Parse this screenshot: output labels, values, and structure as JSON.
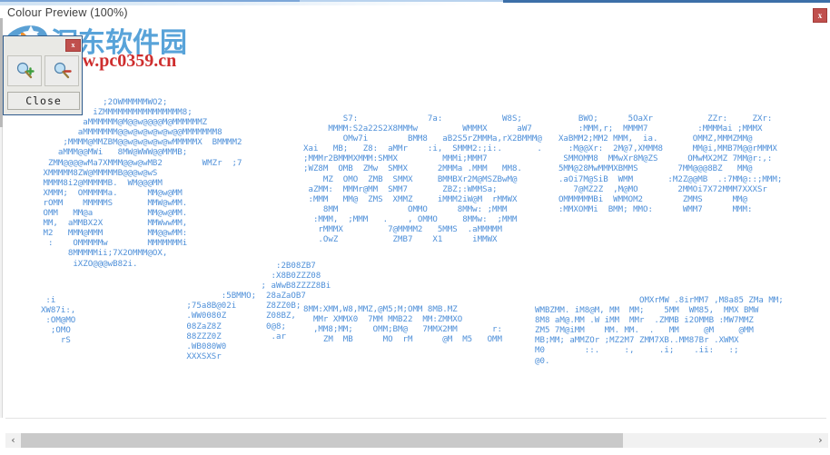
{
  "window": {
    "title": "Colour Preview (100%)",
    "close_label": "x"
  },
  "palette": {
    "close_x_label": "x",
    "zoom_in_icon": "zoom-in-magnifier-icon",
    "zoom_out_icon": "zoom-out-magnifier-icon",
    "close_label": "Close"
  },
  "watermark": {
    "site_name_cn": "洄东软件园",
    "site_url": "www.pc0359.cn"
  },
  "scrollbars": {
    "h_left_arrow": "‹",
    "h_right_arrow": "›"
  },
  "ascii_art": {
    "block_1_blue": "             ;2OWMMMMMWO2;\n           iZMMMMMMMMMMMMMMMM8;\n         aMMMMMM@M@@w@@@@M@MMMMMMZ\n        aMMMMMMM@@w@w@w@w@w@@MMMMMMM8\n     ;MMMM@MMZBM@@w@w@w@w@wMMMMMX  BMMMM2\n    aMMM@@MWi   8MW@WWW@@MMMB;\n  ZMM@@@@wMa7XMMM@@w@wMB2        WMZr  ;7\n XMMMMM8ZW@MMMMMB@@@w@wS\n MMMM8i2@MMMMMB.  WM@@@MM\n XMMM;  OMMMMMa.      MM@w@MM\n rOMM    MMMMMS       MMW@wMM.\n OMM   MM@a           MM@w@MM.\n MM,  aMMBX2X         MMWwwMM,\n M2   MMM@MMM         MM@@wMM:\n  :    OMMMMMw        MMMMMMMi\n      8MMMMMii;7X2OMMM@OX,\n       iXZO@@@wB82i.",
    "block_2_blue_mid": "        S7:              7a:            W8S;\n     MMMM:S2a22S2X8MMMw         WMMMX      aW7\n        OMw7i        BMM8   aB2S5rZMMMa,rX2BMMM@\nXai   MB;   Z8:  aMMr    :i,  SMMM2:;i:.       .\n;MMMr2BMMMXMMM:SMMX         MMMi;MMM7\n;WZ8M  OMB  ZMw  SMMX      2MMMa .MMM   MM8.\n    MZ  OMO  ZMB  SMMX     BMMBXr2M@MSZBwM@\n aZMM:  MMMr@MM  SMM7       ZBZ;:WMMSa;\n :MMM   MM@  ZMS  XMMZ     iMMM2iW@M  rMMWX\n    8MM              OMMO      8MMw: ;MMM\n  :MMM,  ;MMM   .    , OMMO     8MMw:  ;MMM\n   rMMMX         7@MMMM2   5MMS  .aMMMMM\n   .OwZ           ZMB7    X1      iMMWX",
    "block_3_blue_right": "      BWO;      5OaXr           ZZr:     ZXr:\n      :MMM,r;  MMMM7          :MMMMai ;MMMX\n  XaBMM2;MM2 MMM,  ia.       OMMZ,MMMZMM@\n    :M@@Xr:  2M@7,XMMM8      MM@i,MMB7M@@rMMMX\n   SMMOMM8  MMwXr8M@ZS      OMwMX2MZ 7MM@r:,:\n  5MM@28MwMMMXBMMS        7MM@@@8BZ   MM@\n  .aOi7M@SiB  WMM       :M2Z@@MB  .:7MM@::;MMM;\n     7@MZ2Z  ,M@MO        2MMOi7X72MMM7XXXSr\n  OMMMMMMBi  WMMOM2        ZMMS      MM@\n  :MMXOMMi  BMM; MMO:      WMM7      MMM:",
    "block_4_orange": "                     :2B08ZB7\n                    :X8B0ZZZ08\n                  ; aWwB8ZZZZ8Bi\n          :5BMMO;  28aZaOB7\n   ;75a8B@02i      Z8ZZ0B;\n   .WW0080Z        Z08BZ,\n   08ZaZ8Z         0@8;\n   88ZZZ0Z          .ar\n   .WB080W0\n   XXXSXSr",
    "block_5_orange_left": "   :i\n  XW87i:,\n   :OM@MO\n    ;OMO\n      rS",
    "block_6_green": "8MM:XMM,W8,MMZ,@M5;M;OMM 8MB.MZ\n  MMr XMMX0  7MM MMB22  MM:ZMMXO\n  ,MM8;MM;    OMM;BM@   7MMX2MM       r:\n    ZM  MB      MO  rM      @M  M5   OMM",
    "block_7_green_right": "                     OMXrMW .8irMM7 ,M8a85 ZMa MM;\nWMBZMM. iM8@M, MM  MM;    5MM  WM85,  MMX BMW\n8M8 aM@.MM .W iMM  MMr  .ZMMB i2OMMB :MW7MMZ\nZM5 7M@iMM    MM. MM.  .   MM     @M     @MM\nMB;MM; aMMZOr ;MZ2M7 ZMM7XB..MM87Br .XWMX\nM0        ::.     :,     .i;    .ii:   :;\n@0."
  }
}
